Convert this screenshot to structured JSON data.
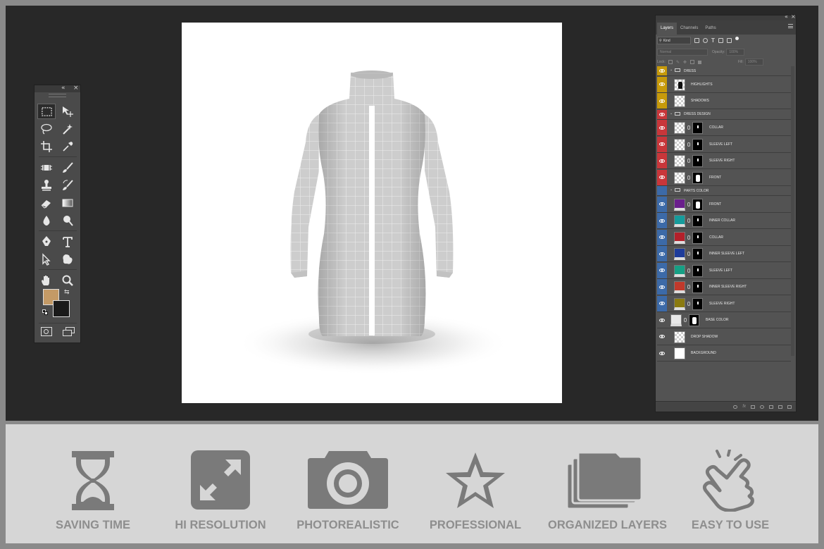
{
  "layers_panel": {
    "tabs": [
      "Layers",
      "Channels",
      "Paths"
    ],
    "filter_kind": "Kind",
    "blend_mode": "Normal",
    "opacity_label": "Opacity:",
    "opacity_value": "100%",
    "lock_label": "Lock:",
    "fill_label": "Fill:",
    "fill_value": "100%",
    "layers": [
      {
        "name": "DRESS",
        "kind": "group",
        "tag": "yellow"
      },
      {
        "name": "HIGHLIGHTS",
        "kind": "layer",
        "tag": "yellow"
      },
      {
        "name": "SHADOWS",
        "kind": "layer",
        "tag": "yellow"
      },
      {
        "name": "DRESS DESIGN",
        "kind": "group",
        "tag": "red"
      },
      {
        "name": "COLLAR",
        "kind": "masked",
        "tag": "red"
      },
      {
        "name": "SLEEVE LEFT",
        "kind": "masked",
        "tag": "red"
      },
      {
        "name": "SLEEVE RIGHT",
        "kind": "masked",
        "tag": "red"
      },
      {
        "name": "FRONT",
        "kind": "masked",
        "tag": "red"
      },
      {
        "name": "PARTS COLOR",
        "kind": "group",
        "tag": "blue"
      },
      {
        "name": "FRONT",
        "kind": "fill",
        "tag": "blue",
        "color": "#6a1f8c"
      },
      {
        "name": "INNER COLLAR",
        "kind": "fill",
        "tag": "blue",
        "color": "#169c9c"
      },
      {
        "name": "COLLAR",
        "kind": "fill",
        "tag": "blue",
        "color": "#b3202a"
      },
      {
        "name": "INNER SLEEVE LEFT",
        "kind": "fill",
        "tag": "blue",
        "color": "#1e3c9a"
      },
      {
        "name": "SLEEVE LEFT",
        "kind": "fill",
        "tag": "blue",
        "color": "#16a085"
      },
      {
        "name": "INNER SLEEVE RIGHT",
        "kind": "fill",
        "tag": "blue",
        "color": "#c0392b"
      },
      {
        "name": "SLEEVE RIGHT",
        "kind": "fill",
        "tag": "blue",
        "color": "#8a7a10"
      },
      {
        "name": "BASE COLOR",
        "kind": "base",
        "tag": "none"
      },
      {
        "name": "DROP SHADOW",
        "kind": "layer",
        "tag": "none"
      },
      {
        "name": "BACKGROUND",
        "kind": "white",
        "tag": "none"
      }
    ]
  },
  "tools": [
    "marquee-icon",
    "move-icon",
    "lasso-icon",
    "magic-wand-icon",
    "crop-icon",
    "eyedropper-icon",
    "healing-brush-icon",
    "brush-icon",
    "clone-stamp-icon",
    "history-brush-icon",
    "eraser-icon",
    "gradient-icon",
    "blur-icon",
    "dodge-icon",
    "pen-icon",
    "type-icon",
    "path-selection-icon",
    "shape-icon",
    "hand-icon",
    "zoom-icon"
  ],
  "colors": {
    "foreground": "#c49a66",
    "background": "#1a1a1a",
    "tag_yellow": "#c79a0a",
    "tag_red": "#c9363a",
    "tag_blue": "#3c6aa8",
    "feature_icon": "#7a7a7a",
    "feature_text": "#8e8e8e"
  },
  "features": [
    {
      "label": "SAVING TIME",
      "icon": "hourglass-icon"
    },
    {
      "label": "HI RESOLUTION",
      "icon": "expand-arrows-icon"
    },
    {
      "label": "PHOTOREALISTIC",
      "icon": "camera-icon"
    },
    {
      "label": "PROFESSIONAL",
      "icon": "star-icon"
    },
    {
      "label": "ORGANIZED LAYERS",
      "icon": "layered-folders-icon"
    },
    {
      "label": "EASY TO USE",
      "icon": "tap-hand-icon"
    }
  ]
}
